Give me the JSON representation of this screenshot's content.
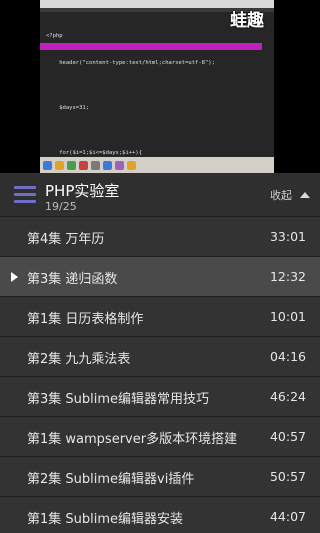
{
  "video": {
    "watermark": "蛙趣",
    "code_lines": [
      "<?php",
      "    header(\"content-type:text/html;charset=utf-8\");",
      "",
      "    $days=31;",
      "",
      "    for($i=1;$i<=$days;$i++){",
      "",
      "    }",
      "?>"
    ]
  },
  "header": {
    "title": "PHP实验室",
    "progress": "19/25",
    "collapse_label": "收起"
  },
  "episodes": [
    {
      "title": "第4集 万年历",
      "duration": "33:01",
      "active": false
    },
    {
      "title": "第3集 递归函数",
      "duration": "12:32",
      "active": true
    },
    {
      "title": "第1集 日历表格制作",
      "duration": "10:01",
      "active": false
    },
    {
      "title": "第2集 九九乘法表",
      "duration": "04:16",
      "active": false
    },
    {
      "title": "第3集 Sublime编辑器常用技巧",
      "duration": "46:24",
      "active": false
    },
    {
      "title": "第1集 wampserver多版本环境搭建",
      "duration": "40:57",
      "active": false
    },
    {
      "title": "第2集 Sublime编辑器vi插件",
      "duration": "50:57",
      "active": false
    },
    {
      "title": "第1集 Sublime编辑器安装",
      "duration": "44:07",
      "active": false
    }
  ],
  "colors": {
    "accent": "#6d6fc9",
    "highlight": "#c020c0"
  }
}
